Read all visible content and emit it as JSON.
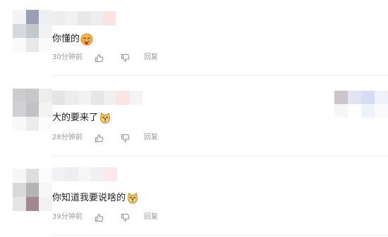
{
  "comments": [
    {
      "text": "你懂的",
      "emoji": "smirk-face",
      "time": "30分钟前",
      "reply_label": "回复"
    },
    {
      "text": "大的要来了",
      "emoji": "doge-face",
      "time": "28分钟前",
      "reply_label": "回复"
    },
    {
      "text": "你知道我要说啥的",
      "emoji": "doge-face",
      "time": "39分钟前",
      "reply_label": "回复"
    }
  ],
  "colors": {
    "text": "#222222",
    "meta": "#999999",
    "divider": "#eeeeee"
  }
}
